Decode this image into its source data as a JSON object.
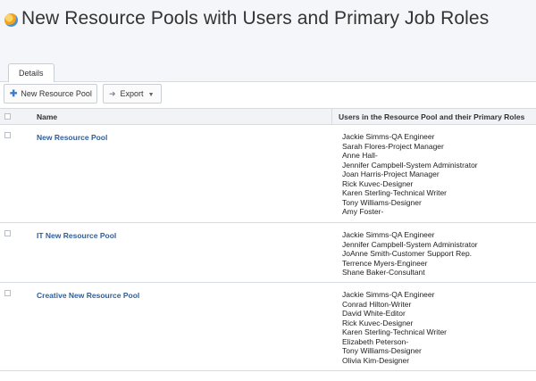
{
  "page": {
    "title": "New Resource Pools with Users and Primary Job Roles",
    "title_icon": "pie-chart-icon"
  },
  "tabs": [
    {
      "label": "Details",
      "active": true
    }
  ],
  "toolbar": {
    "new_pool_label": "New Resource Pool",
    "new_pool_icon": "plus-icon",
    "export_label": "Export",
    "export_icon": "arrow-right-icon",
    "export_caret_icon": "caret-down-icon"
  },
  "table": {
    "columns": [
      "Name",
      "Users in the Resource Pool and their Primary Roles"
    ],
    "rows": [
      {
        "name": "New Resource Pool",
        "users": [
          "Jackie Simms-QA Engineer",
          "Sarah Flores-Project Manager",
          "Anne Hall-",
          "Jennifer Campbell-System Administrator",
          "Joan Harris-Project Manager",
          "Rick Kuvec-Designer",
          "Karen Sterling-Technical Writer",
          "Tony Williams-Designer",
          "Amy Foster-"
        ]
      },
      {
        "name": "IT New Resource Pool",
        "users": [
          "Jackie Simms-QA Engineer",
          "Jennifer Campbell-System Administrator",
          "JoAnne Smith-Customer Support Rep.",
          "Terrence Myers-Engineer",
          "Shane Baker-Consultant"
        ]
      },
      {
        "name": "Creative New Resource Pool",
        "users": [
          "Jackie Simms-QA Engineer",
          "Conrad Hilton-Writer",
          "David White-Editor",
          "Rick Kuvec-Designer",
          "Karen Sterling-Technical Writer",
          "Elizabeth Peterson-",
          "Tony Williams-Designer",
          "Olivia Kim-Designer"
        ]
      }
    ]
  },
  "colors": {
    "link": "#2f5f9b",
    "header_bg": "#f4f6f9",
    "border": "#d6dbe2",
    "accent": "#3d7cc9"
  }
}
